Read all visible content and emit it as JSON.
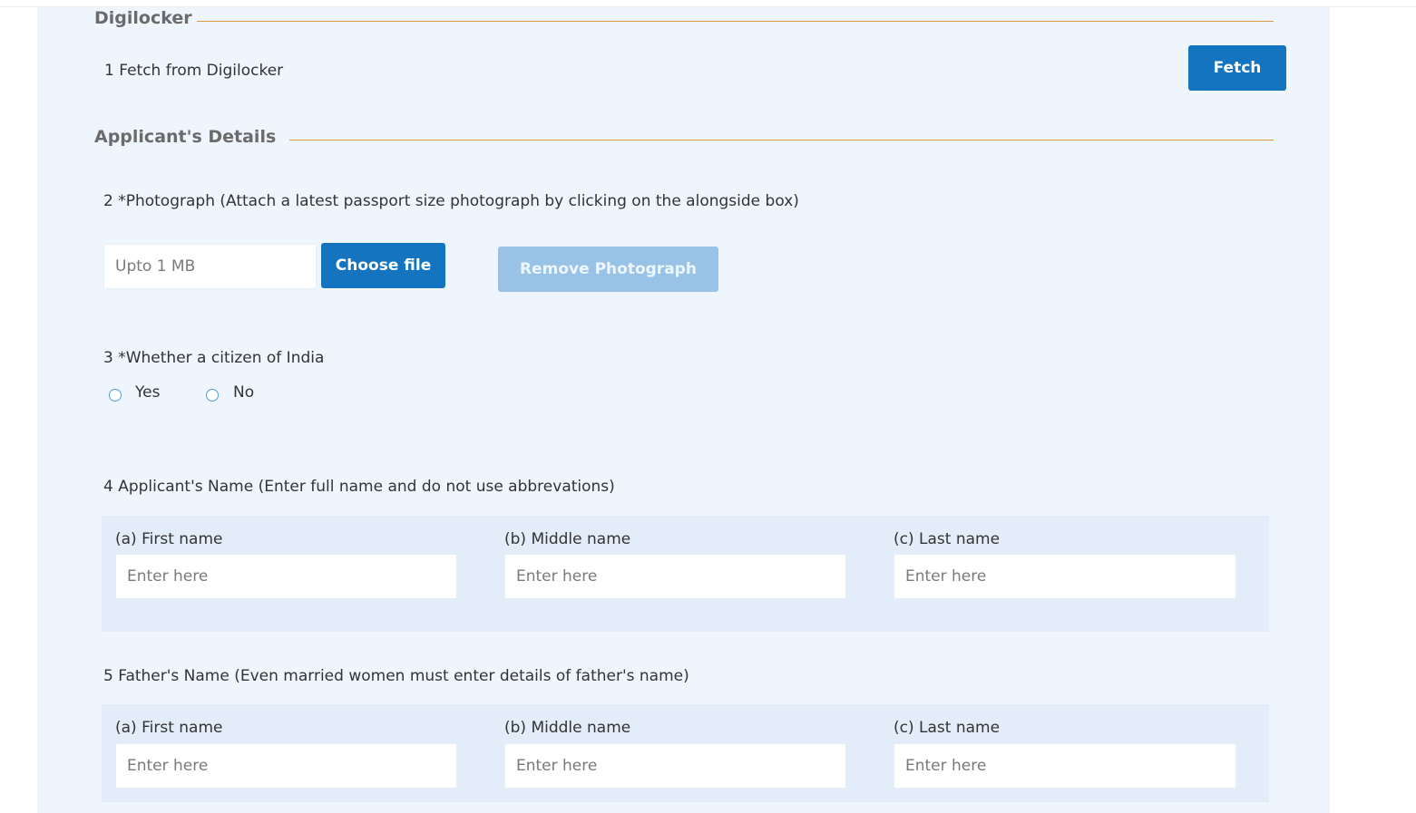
{
  "digilocker": {
    "section_title": "Digilocker",
    "item_label": "1 Fetch from Digilocker",
    "fetch_button": "Fetch"
  },
  "applicant": {
    "section_title": "Applicant's Details",
    "photograph": {
      "label": "2 *Photograph (Attach a latest passport size photograph by clicking on the alongside box)",
      "file_placeholder": "Upto 1 MB",
      "choose_button": "Choose file",
      "remove_button": "Remove Photograph"
    },
    "citizen": {
      "label": "3 *Whether a citizen of India",
      "options": [
        "Yes",
        "No"
      ]
    },
    "applicant_name": {
      "label": "4 Applicant's Name (Enter full name and do not use abbrevations)",
      "first_label": "(a) First name",
      "middle_label": "(b) Middle name",
      "last_label": "(c) Last name",
      "placeholder": "Enter here"
    },
    "father_name": {
      "label": "5 Father's Name (Even married women must enter details of father's name)",
      "first_label": "(a) First name",
      "middle_label": "(b) Middle name",
      "last_label": "(c) Last name",
      "placeholder": "Enter here"
    }
  },
  "colors": {
    "primary_button": "#1474bf",
    "disabled_button": "#99c3e6",
    "section_line": "#e0994a",
    "panel_background": "#eff5fd",
    "name_box_background": "#e3edf9"
  }
}
